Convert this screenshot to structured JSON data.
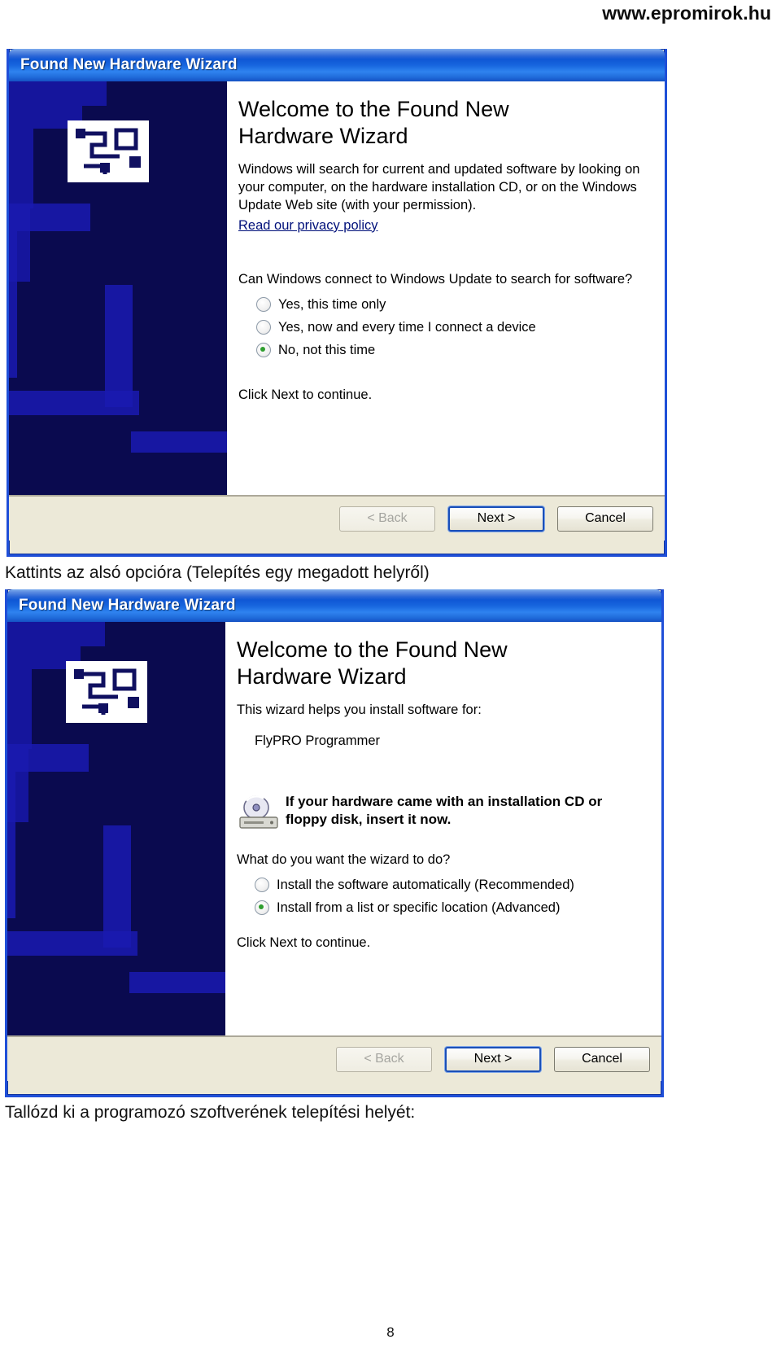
{
  "header": {
    "url": "www.epromirok.hu"
  },
  "dialog1": {
    "title": "Found New Hardware Wizard",
    "heading": "Welcome to the Found New Hardware Wizard",
    "paragraph": "Windows will search for current and updated software by looking on your computer, on the hardware installation CD, or on the Windows Update Web site (with your permission).",
    "link": "Read our privacy policy",
    "question": "Can Windows connect to Windows Update to search for software?",
    "options": [
      {
        "label": "Yes, this time only",
        "checked": false
      },
      {
        "label": "Yes, now and every time I connect a device",
        "checked": false
      },
      {
        "label": "No, not this time",
        "checked": true
      }
    ],
    "footer_hint": "Click Next to continue.",
    "buttons": {
      "back": "< Back",
      "next": "Next >",
      "cancel": "Cancel"
    }
  },
  "caption1": "Kattints az alsó opcióra (Telepítés egy megadott helyről)",
  "dialog2": {
    "title": "Found New Hardware Wizard",
    "heading": "Welcome to the Found New Hardware Wizard",
    "paragraph": "This wizard helps you install software for:",
    "device_name": "FlyPRO Programmer",
    "cd_note": "If your hardware came with an installation CD or floppy disk, insert it now.",
    "question": "What do you want the wizard to do?",
    "options": [
      {
        "label": "Install the software automatically (Recommended)",
        "checked": false
      },
      {
        "label": "Install from a list or specific location (Advanced)",
        "checked": true
      }
    ],
    "footer_hint": "Click Next to continue.",
    "buttons": {
      "back": "< Back",
      "next": "Next >",
      "cancel": "Cancel"
    }
  },
  "caption2": "Tallózd ki a programozó szoftverének telepítési helyét:",
  "page_number": "8",
  "colors": {
    "titlebar_blue": "#0a4fd0",
    "window_border": "#1f4fd8",
    "sidebar_navy": "#0a0a4f",
    "sidebar_watermark": "#1a1ab0",
    "dialog_face": "#ece9d8",
    "link": "#00107a",
    "radio_dot_green": "#2f9e2f"
  }
}
